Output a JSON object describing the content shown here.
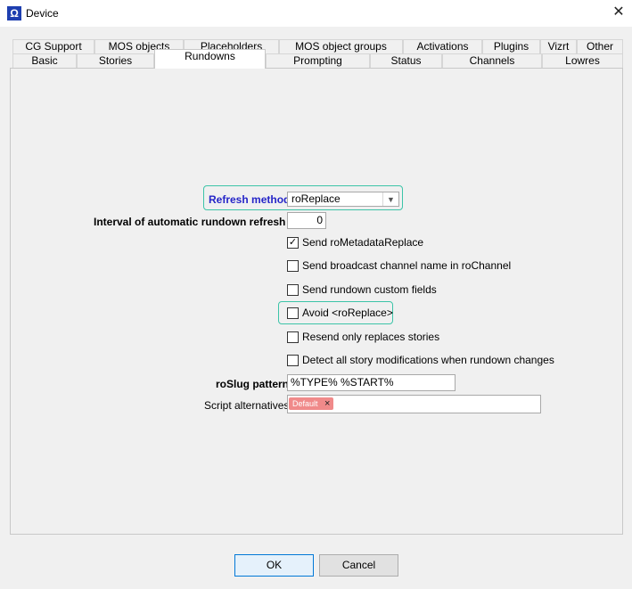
{
  "window": {
    "title": "Device",
    "app_icon": "Ω",
    "close_glyph": "✕"
  },
  "tabs_top": [
    "CG Support",
    "MOS objects",
    "Placeholders",
    "MOS object groups",
    "Activations",
    "Plugins",
    "Vizrt",
    "Other"
  ],
  "tabs_bottom": [
    "Basic",
    "Stories",
    "Rundowns",
    "Prompting",
    "Status",
    "Channels",
    "Lowres"
  ],
  "active_tab": "Rundowns",
  "form": {
    "refresh_method_label": "Refresh method:",
    "refresh_method_value": "roReplace",
    "interval_label": "Interval of automatic rundown refresh [s]:",
    "interval_value": "0",
    "checkboxes": [
      {
        "label": "Send roMetadataReplace",
        "checked": true
      },
      {
        "label": "Send broadcast channel name in roChannel",
        "checked": false
      },
      {
        "label": "Send rundown custom fields",
        "checked": false
      },
      {
        "label": "Avoid <roReplace>",
        "checked": false
      },
      {
        "label": "Resend only replaces stories",
        "checked": false
      },
      {
        "label": "Detect all story modifications when rundown changes",
        "checked": false
      }
    ],
    "roslug_label": "roSlug pattern:",
    "roslug_value": "%TYPE% %START%",
    "script_label": "Script alternatives:",
    "script_chip": "Default",
    "chip_remove": "×"
  },
  "buttons": {
    "ok": "OK",
    "cancel": "Cancel"
  },
  "colors": {
    "highlight": "#3cc4a8",
    "refresh_label": "#2525c8",
    "chip": "#f08a8a",
    "ok_border": "#0078d7"
  },
  "icons": {
    "app": "omega-icon",
    "close": "close-icon",
    "dropdown": "chevron-down-icon",
    "chip_remove": "remove-tag-icon"
  }
}
